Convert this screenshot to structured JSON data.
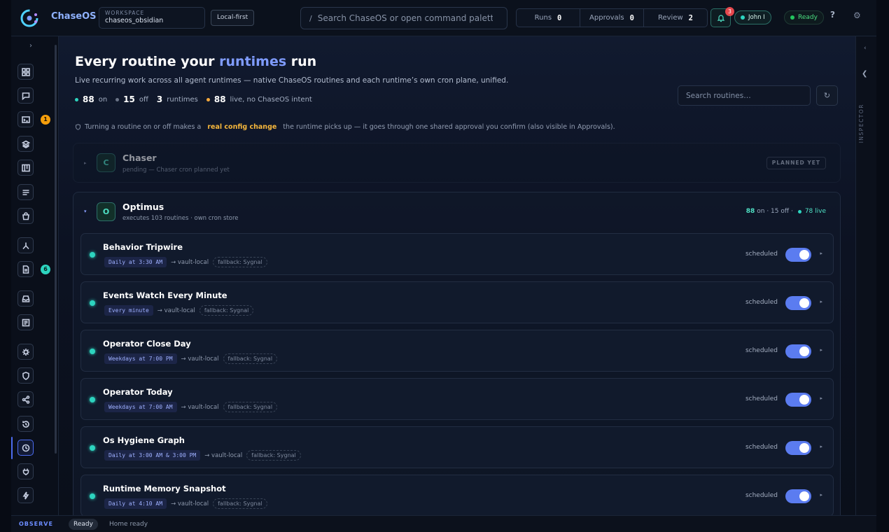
{
  "app": {
    "brand": "ChaseOS",
    "workspace_label": "WORKSPACE",
    "workspace_name": "chaseos_obsidian",
    "mode_badge": "Local-first"
  },
  "header": {
    "search_slash": "/",
    "search_placeholder": "Search ChaseOS or open command palette",
    "counters": [
      {
        "label": "Runs",
        "value": "0"
      },
      {
        "label": "Approvals",
        "value": "0"
      },
      {
        "label": "Review",
        "value": "2"
      }
    ],
    "notifications_count": "3",
    "user": "John I",
    "status": "Ready",
    "help": "?",
    "colors": {
      "accent": "#7f9cff",
      "teal": "#2dd4bf",
      "warning": "#f6b73c",
      "danger": "#e5484d"
    }
  },
  "rail": {
    "items": [
      {
        "icon": "grid-icon",
        "badge": ""
      },
      {
        "icon": "chat-icon",
        "badge": ""
      },
      {
        "icon": "terminal-icon",
        "badge": "1"
      },
      {
        "icon": "layers-icon",
        "badge": ""
      },
      {
        "icon": "board-icon",
        "badge": ""
      },
      {
        "icon": "list-icon",
        "badge": ""
      },
      {
        "icon": "bag-icon",
        "badge": ""
      },
      {
        "icon": "branch-icon",
        "badge": ""
      },
      {
        "icon": "document-icon",
        "badge": "6"
      },
      {
        "icon": "inbox-icon",
        "badge": ""
      },
      {
        "icon": "news-icon",
        "badge": ""
      },
      {
        "icon": "chip-icon",
        "badge": ""
      },
      {
        "icon": "shield-icon",
        "badge": ""
      },
      {
        "icon": "share-icon",
        "badge": ""
      },
      {
        "icon": "history-icon",
        "badge": ""
      },
      {
        "icon": "clock-icon",
        "badge": ""
      },
      {
        "icon": "plug-icon",
        "badge": ""
      },
      {
        "icon": "bolt-icon",
        "badge": ""
      }
    ]
  },
  "page": {
    "title_pre": "Every routine your ",
    "title_accent": "runtimes",
    "title_post": " run",
    "subtitle": "Live recurring work across all agent runtimes — native ChaseOS routines and each runtime’s own cron plane, unified.",
    "stats": {
      "on_count": "88",
      "on_label": "on",
      "off_count": "15",
      "off_label": "off",
      "runtimes_count": "3",
      "runtimes_label": "runtimes",
      "live_count": "88",
      "live_label": "live, no ChaseOS intent"
    },
    "search_placeholder": "Search routines…",
    "notice_pre": "Turning a routine on or off makes a",
    "notice_highlight": "real config change",
    "notice_post": "the runtime picks up — it goes through one shared approval you confirm (also visible in Approvals)."
  },
  "runtimes": {
    "chaser": {
      "initial": "C",
      "name": "Chaser",
      "sub": "pending — Chaser cron planned yet",
      "badge": "PLANNED YET"
    },
    "optimus": {
      "initial": "O",
      "name": "Optimus",
      "sub": "executes 103 routines · own cron store",
      "on": "88",
      "on_suffix": "on · 15 off ·",
      "live": "78 live"
    }
  },
  "routines": [
    {
      "name": "Behavior Tripwire",
      "schedule": "Daily at 3:30 AM",
      "target": "→ vault-local",
      "fallback": "fallback: Sygnal",
      "state": "scheduled"
    },
    {
      "name": "Events Watch Every Minute",
      "schedule": "Every minute",
      "target": "→ vault-local",
      "fallback": "fallback: Sygnal",
      "state": "scheduled"
    },
    {
      "name": "Operator Close Day",
      "schedule": "Weekdays at 7:00 PM",
      "target": "→ vault-local",
      "fallback": "fallback: Sygnal",
      "state": "scheduled"
    },
    {
      "name": "Operator Today",
      "schedule": "Weekdays at 7:00 AM",
      "target": "→ vault-local",
      "fallback": "fallback: Sygnal",
      "state": "scheduled"
    },
    {
      "name": "Os Hygiene Graph",
      "schedule": "Daily at 3:00 AM & 3:00 PM",
      "target": "→ vault-local",
      "fallback": "fallback: Sygnal",
      "state": "scheduled"
    },
    {
      "name": "Runtime Memory Snapshot",
      "schedule": "Daily at 4:10 AM",
      "target": "→ vault-local",
      "fallback": "fallback: Sygnal",
      "state": "scheduled"
    }
  ],
  "inspector": {
    "label": "INSPECTOR"
  },
  "statusbar": {
    "mode": "OBSERVE",
    "state": "Ready",
    "message": "Home ready"
  }
}
